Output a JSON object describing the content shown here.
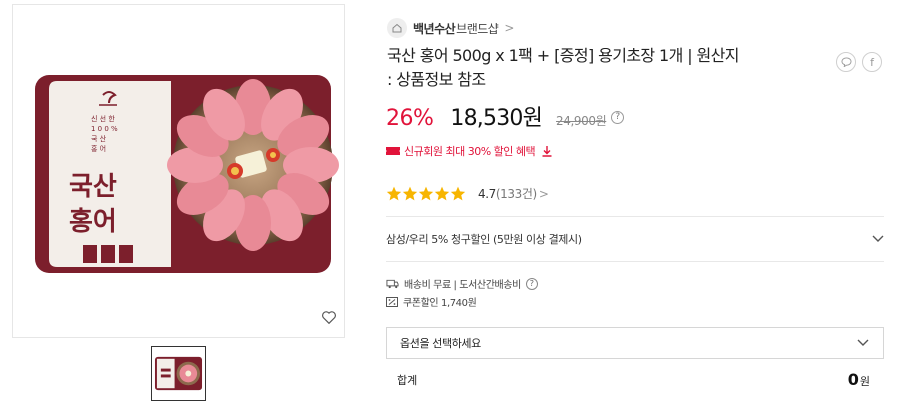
{
  "product": {
    "images": {
      "main_alt": "국산 홍어 상품 이미지",
      "package_text_main": "국산\n홍어",
      "package_text_small": "신선한 100% 국산 홍어"
    },
    "store": {
      "name": "백년수산",
      "suffix": "브랜드샵",
      "chevron": ">"
    },
    "title": "국산 홍어 500g x 1팩 + [증정] 용기초장 1개 | 원산지 : 상품정보 참조",
    "share": {
      "talk_icon": "speech-bubble-icon",
      "facebook_label": "f"
    },
    "price": {
      "discount": "26%",
      "sale": "18,530원",
      "original": "24,900원",
      "info_symbol": "?"
    },
    "coupon": {
      "text": "신규회원 최대 30% 할인 혜택",
      "color": "#e1133a"
    },
    "rating": {
      "score": "4.7",
      "count": "(133건)",
      "stars": 5,
      "star_color": "#f7b500",
      "chevron": ">"
    },
    "card_benefit": {
      "text": "삼성/우리 5% 청구할인 (5만원 이상 결제시)"
    },
    "shipping": {
      "text": "배송비 무료 | 도서산간배송비",
      "info_symbol": "?"
    },
    "coupon_discount": {
      "text": "쿠폰할인 1,740원"
    },
    "option_select": {
      "placeholder": "옵션을 선택하세요"
    },
    "total": {
      "label": "합계",
      "amount": "0",
      "unit": "원"
    }
  },
  "colors": {
    "accent_red": "#e1133a",
    "package_burgundy": "#7c1f2c",
    "divider": "#e8e8e8"
  }
}
